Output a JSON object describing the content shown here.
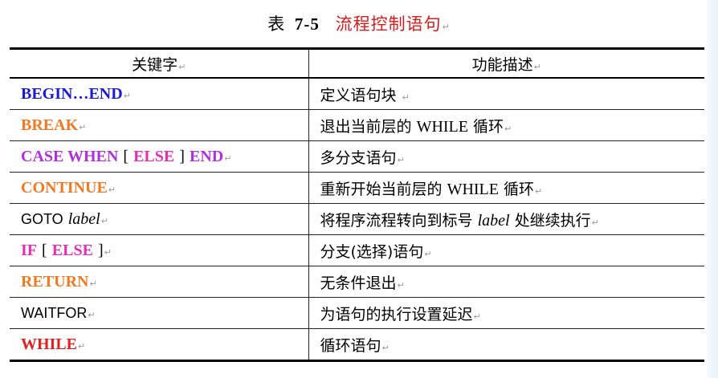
{
  "caption": {
    "label": "表",
    "number": "7-5",
    "title": "流程控制语句"
  },
  "table": {
    "headers": {
      "keyword": "关键字",
      "description": "功能描述"
    },
    "rows": [
      {
        "kw": [
          {
            "text": "BEGIN…END",
            "color": "#1a1ad6"
          }
        ],
        "desc": [
          "定义语句块"
        ]
      },
      {
        "kw": [
          {
            "text": "BREAK",
            "color": "#f07a24"
          }
        ],
        "desc": [
          "退出当前层的",
          "WHILE",
          "循环"
        ]
      },
      {
        "kw": [
          {
            "text": "CASE WHEN",
            "color": "#b030e0"
          },
          {
            "text": "[",
            "color": "#000000"
          },
          {
            "text": "ELSE",
            "color": "#e62eb4"
          },
          {
            "text": "]",
            "color": "#000000"
          },
          {
            "text": "END",
            "color": "#b030e0"
          }
        ],
        "desc": [
          "多分支语句"
        ]
      },
      {
        "kw": [
          {
            "text": "CONTINUE",
            "color": "#f07a24"
          }
        ],
        "desc": [
          "重新开始当前层的",
          "WHILE",
          "循环"
        ]
      },
      {
        "kw": [
          {
            "text": "GOTO",
            "color": "#000000"
          },
          {
            "text": "label",
            "color": "#000000"
          }
        ],
        "desc": [
          "将程序流程转向到标号",
          "label",
          "处继续执行"
        ]
      },
      {
        "kw": [
          {
            "text": "IF",
            "color": "#e62eb4"
          },
          {
            "text": "[",
            "color": "#000000"
          },
          {
            "text": "ELSE",
            "color": "#e62eb4"
          },
          {
            "text": "]",
            "color": "#000000"
          }
        ],
        "desc": [
          "分支(选择)语句"
        ]
      },
      {
        "kw": [
          {
            "text": "RETURN",
            "color": "#f07a24"
          }
        ],
        "desc": [
          "无条件退出"
        ]
      },
      {
        "kw": [
          {
            "text": "WAITFOR",
            "color": "#000000"
          }
        ],
        "desc": [
          "为语句的执行设置延迟"
        ]
      },
      {
        "kw": [
          {
            "text": "WHILE",
            "color": "#e41e1e"
          }
        ],
        "desc": [
          "循环语句"
        ]
      }
    ]
  }
}
